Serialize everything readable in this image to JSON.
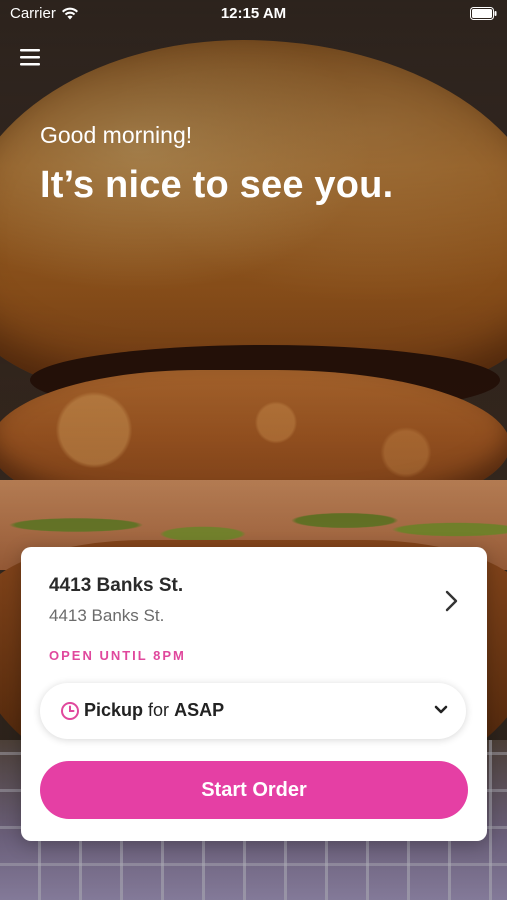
{
  "status_bar": {
    "carrier": "Carrier",
    "time": "12:15 AM",
    "wifi_icon": "wifi-icon",
    "battery_icon": "battery-icon"
  },
  "header": {
    "menu_icon": "hamburger-menu-icon",
    "greeting": "Good morning!",
    "headline": "It’s nice to see you."
  },
  "location_card": {
    "name": "4413 Banks St.",
    "address": "4413 Banks St.",
    "hours": "OPEN UNTIL 8PM",
    "chevron_icon": "chevron-right-icon",
    "order_mode": {
      "icon": "clock-icon",
      "method": "Pickup",
      "connector": "for",
      "time": "ASAP",
      "dropdown_icon": "chevron-down-icon"
    },
    "start_button_label": "Start Order"
  },
  "colors": {
    "accent": "#e53fa4",
    "accent_text": "#e0489d",
    "card_background": "#ffffff",
    "title_text": "#2a2a2a",
    "secondary_text": "#6b6b6b"
  }
}
